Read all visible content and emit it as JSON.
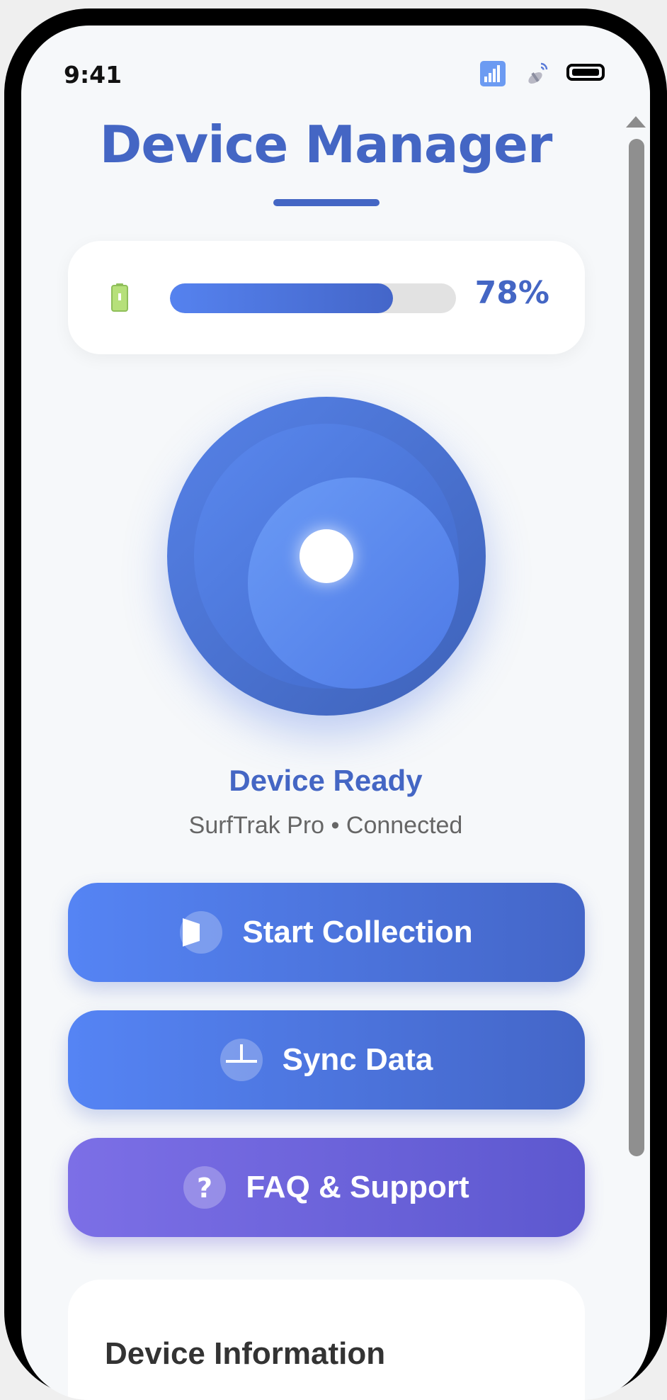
{
  "status_bar": {
    "time": "9:41",
    "icons": [
      "signal-icon",
      "satellite-icon",
      "battery-icon"
    ]
  },
  "page": {
    "title": "Device Manager"
  },
  "battery": {
    "icon": "battery-icon",
    "level": 0.78,
    "percent_label": "78%"
  },
  "device": {
    "status": "Device Ready",
    "subtitle": "SurfTrak Pro • Connected"
  },
  "actions": [
    {
      "label": "Start Collection",
      "icon": "play-icon"
    },
    {
      "label": "Sync Data",
      "icon": "sync-icon"
    },
    {
      "label": "FAQ & Support",
      "icon": "question-icon"
    }
  ],
  "info": {
    "title": "Device Information"
  },
  "colors": {
    "accent": "#4466c4",
    "button_blue": "#5584f4",
    "button_purple": "#7c6fe6",
    "background": "#f6f8fa"
  }
}
